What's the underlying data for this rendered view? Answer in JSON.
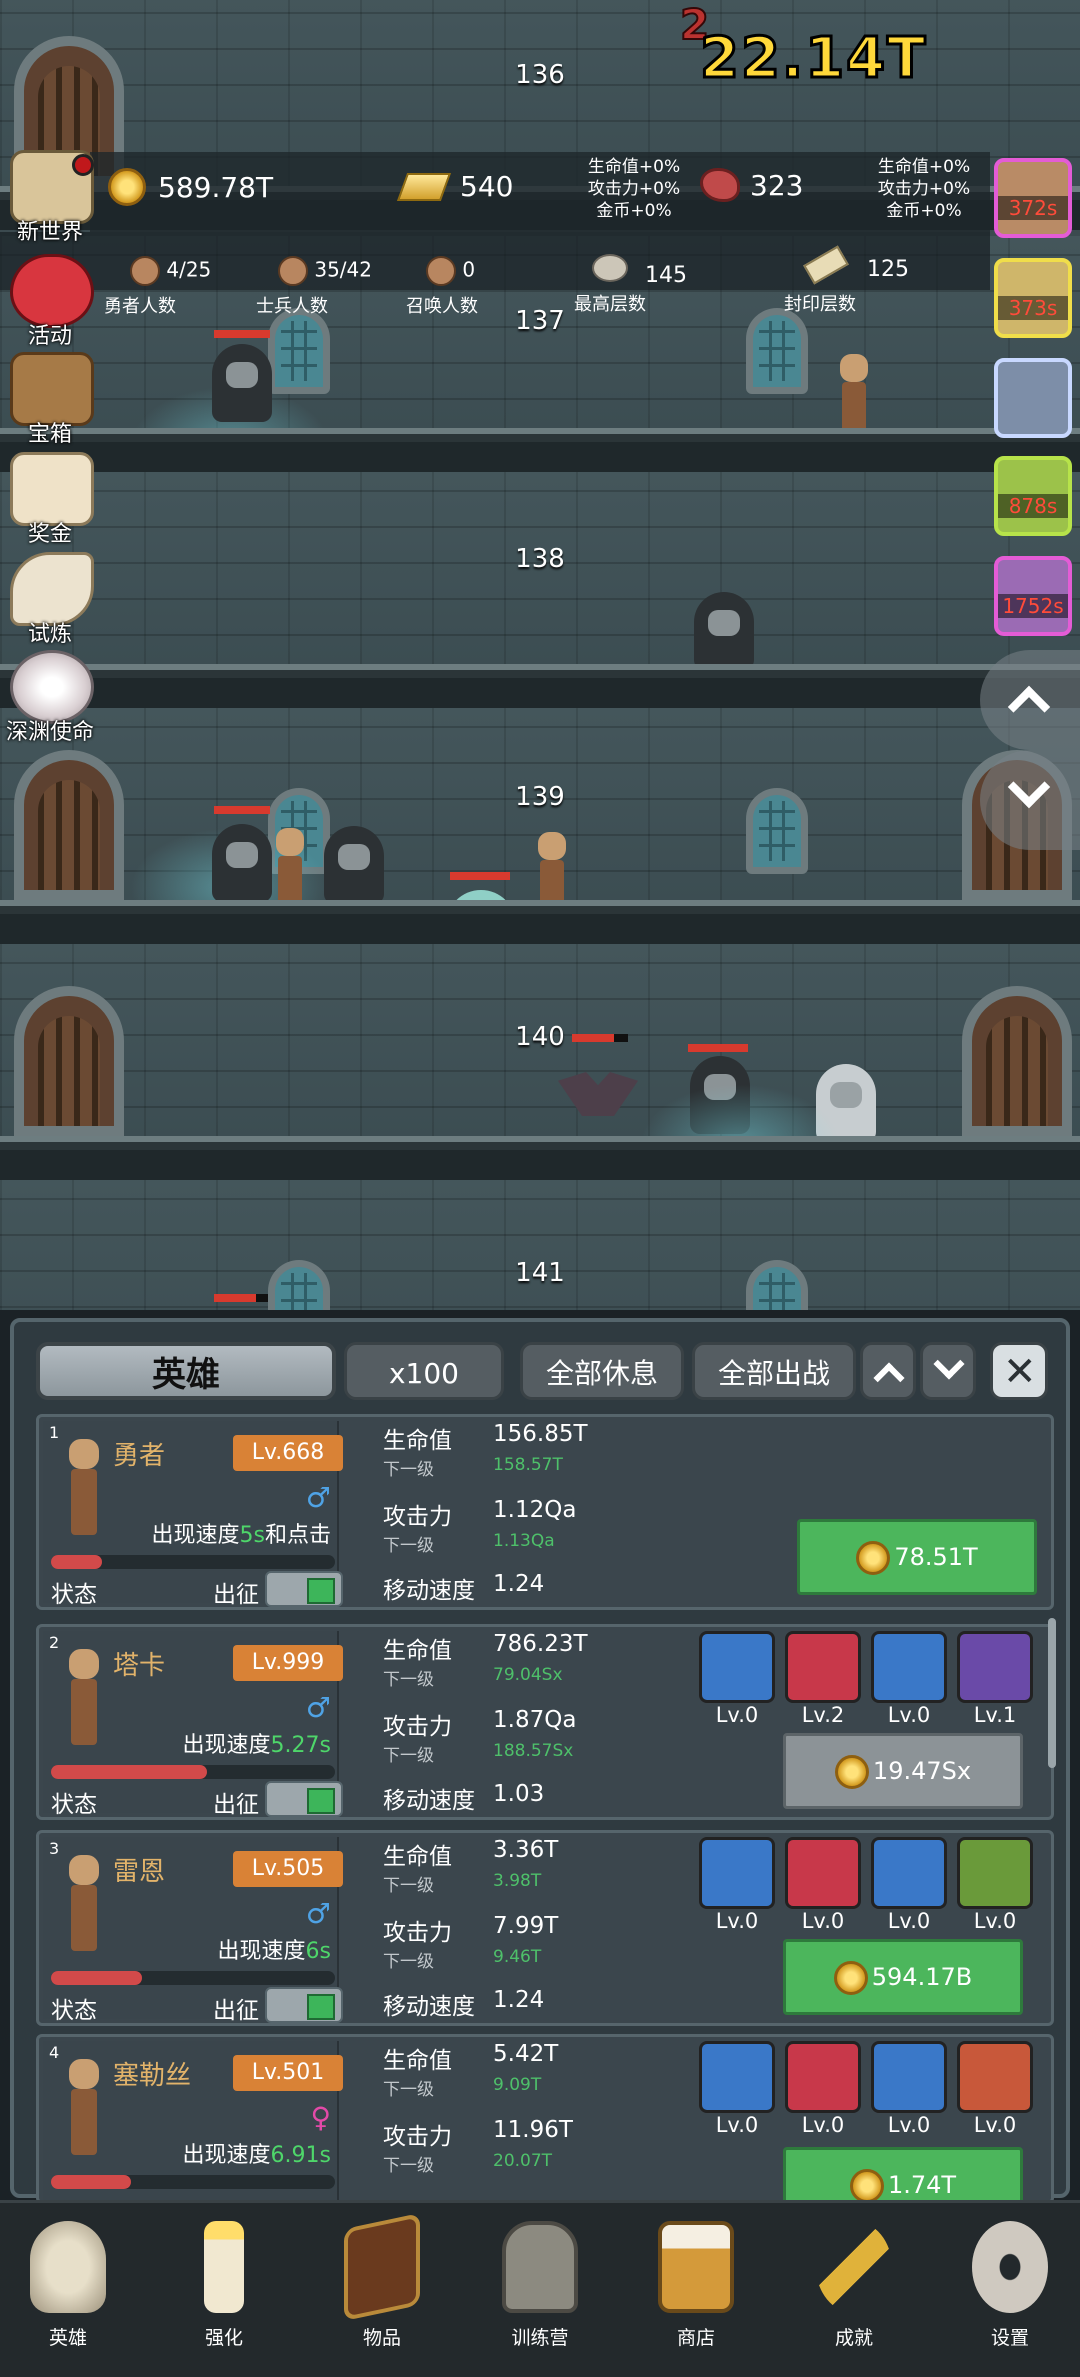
{
  "scene": {
    "floors": [
      "136",
      "137",
      "138",
      "139",
      "140",
      "141"
    ],
    "damage_text": "22.14T"
  },
  "hud": {
    "gold": "589.78T",
    "gold_bars": "540",
    "meat": "323",
    "bonus_left": [
      "生命值+0%",
      "攻击力+0%",
      "金币+0%"
    ],
    "bonus_right": [
      "生命值+0%",
      "攻击力+0%",
      "金币+0%"
    ],
    "hero_count": {
      "value": "4/25",
      "label": "勇者人数"
    },
    "soldier_count": {
      "value": "35/42",
      "label": "士兵人数"
    },
    "summon_count": {
      "value": "0",
      "label": "召唤人数"
    },
    "max_floor": {
      "value": "145",
      "label": "最高层数"
    },
    "sealed_floor": {
      "value": "125",
      "label": "封印层数"
    }
  },
  "side_menu": [
    "新世界",
    "活动",
    "宝箱",
    "奖金",
    "试炼",
    "深渊使命"
  ],
  "buffs": [
    "372s",
    "373s",
    "",
    "878s",
    "1752s"
  ],
  "panel": {
    "title": "英雄",
    "multiplier": "x100",
    "rest_all": "全部休息",
    "deploy_all": "全部出战",
    "labels": {
      "hp": "生命值",
      "next": "下一级",
      "atk": "攻击力",
      "move": "移动速度",
      "status": "状态",
      "deploy": "出征"
    },
    "heroes": [
      {
        "index": "1",
        "name": "勇者",
        "level": "Lv.668",
        "gender": "♂",
        "speed_prefix": "出现速度",
        "speed_value": "5s",
        "speed_suffix": "和点击",
        "hp": "156.85T",
        "hp_next": "158.57T",
        "atk": "1.12Qa",
        "atk_next": "1.13Qa",
        "move": "1.24",
        "cost": "78.51T",
        "hp_bar": 0.18,
        "affordable": true,
        "equips": []
      },
      {
        "index": "2",
        "name": "塔卡",
        "level": "Lv.999",
        "gender": "♂",
        "speed_prefix": "出现速度",
        "speed_value": "5.27s",
        "speed_suffix": "",
        "hp": "786.23T",
        "hp_next": "79.04Sx",
        "atk": "1.87Qa",
        "atk_next": "188.57Sx",
        "move": "1.03",
        "cost": "19.47Sx",
        "hp_bar": 0.55,
        "affordable": false,
        "equips": [
          "Lv.0",
          "Lv.2",
          "Lv.0",
          "Lv.1"
        ]
      },
      {
        "index": "3",
        "name": "雷恩",
        "level": "Lv.505",
        "gender": "♂",
        "speed_prefix": "出现速度",
        "speed_value": "6s",
        "speed_suffix": "",
        "hp": "3.36T",
        "hp_next": "3.98T",
        "atk": "7.99T",
        "atk_next": "9.46T",
        "move": "1.24",
        "cost": "594.17B",
        "hp_bar": 0.32,
        "affordable": true,
        "equips": [
          "Lv.0",
          "Lv.0",
          "Lv.0",
          "Lv.0"
        ]
      },
      {
        "index": "4",
        "name": "塞勒丝",
        "level": "Lv.501",
        "gender": "♀",
        "speed_prefix": "出现速度",
        "speed_value": "6.91s",
        "speed_suffix": "",
        "hp": "5.42T",
        "hp_next": "9.09T",
        "atk": "11.96T",
        "atk_next": "20.07T",
        "move": "",
        "cost": "1.74T",
        "hp_bar": 0.28,
        "affordable": true,
        "equips": [
          "Lv.0",
          "Lv.0",
          "Lv.0",
          "Lv.0"
        ]
      }
    ]
  },
  "nav": [
    "英雄",
    "强化",
    "物品",
    "训练营",
    "商店",
    "成就",
    "设置"
  ]
}
